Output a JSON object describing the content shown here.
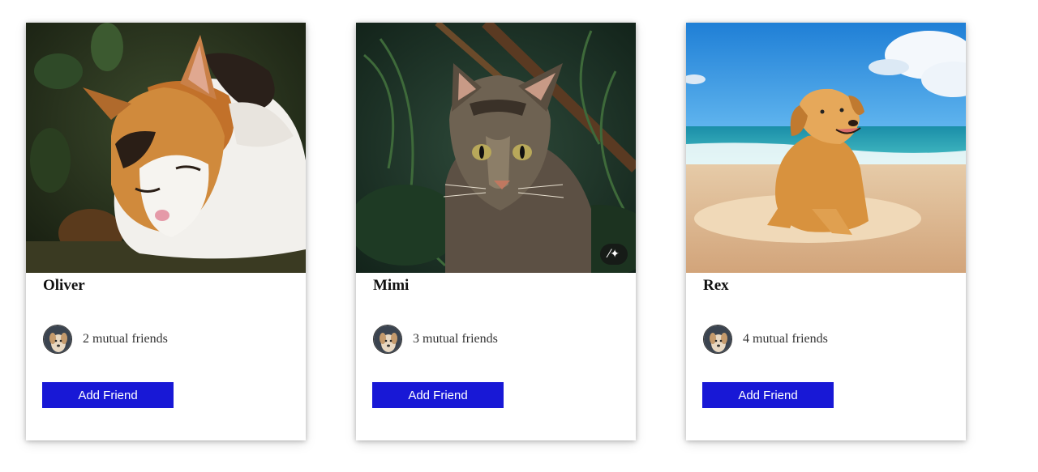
{
  "cards": [
    {
      "name": "Oliver",
      "mutual_friends": "2 mutual friends",
      "button_label": "Add Friend",
      "photo_subject": "calico-cat"
    },
    {
      "name": "Mimi",
      "mutual_friends": "3 mutual friends",
      "button_label": "Add Friend",
      "photo_subject": "tabby-cat",
      "photo_badge_icon": "magic-wand-icon"
    },
    {
      "name": "Rex",
      "mutual_friends": "4 mutual friends",
      "button_label": "Add Friend",
      "photo_subject": "golden-retriever-beach"
    }
  ],
  "colors": {
    "button_bg": "#1818d6",
    "button_text": "#ffffff",
    "card_bg": "#ffffff"
  }
}
